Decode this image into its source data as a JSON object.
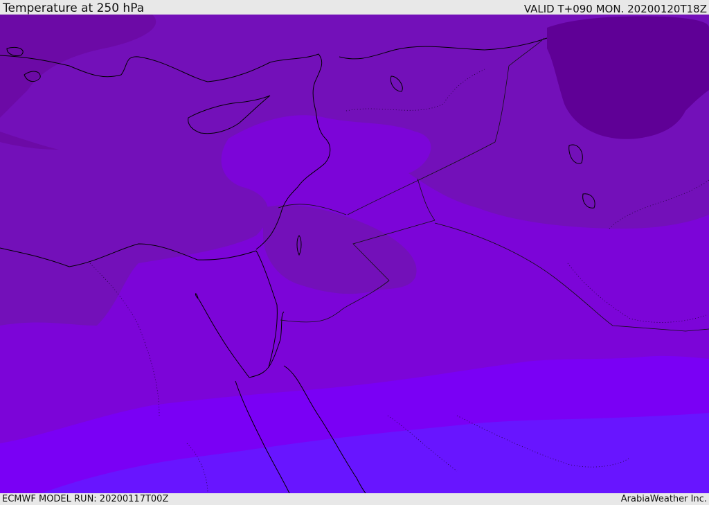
{
  "header": {
    "title": "Temperature at 250 hPa",
    "valid": "VALID T+090 MON. 20200120T18Z"
  },
  "footer": {
    "model_run": "ECMWF MODEL RUN: 20200117T00Z",
    "credit": "ArabiaWeather Inc."
  },
  "map": {
    "field": "temperature-250hPa-shaded",
    "region": "Eastern Mediterranean / Levant / Northern Egypt",
    "colors": {
      "coldest": "#5f0096",
      "cold": "#6c0aa6",
      "mid": "#7310b9",
      "mild": "#7c05d8",
      "warm": "#7a00f5",
      "warmest": "#6815ff",
      "coastline": "#000000"
    }
  }
}
